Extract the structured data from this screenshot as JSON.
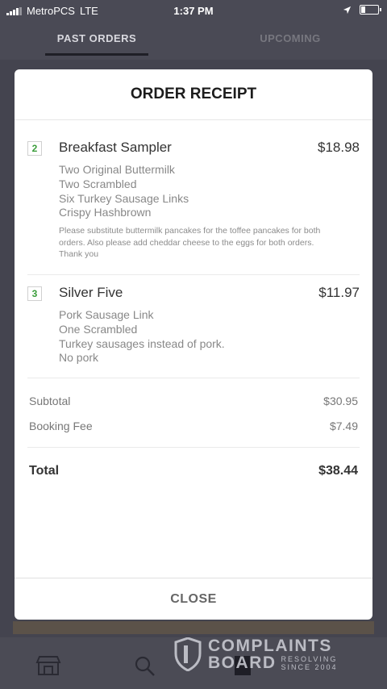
{
  "status_bar": {
    "carrier": "MetroPCS",
    "network": "LTE",
    "time": "1:37 PM"
  },
  "background_tabs": {
    "past": "PAST ORDERS",
    "upcoming": "UPCOMING"
  },
  "modal": {
    "title": "ORDER RECEIPT",
    "items": [
      {
        "quantity": "2",
        "name": "Breakfast Sampler",
        "price": "$18.98",
        "modifiers": [
          "Two Original Buttermilk",
          "Two Scrambled",
          "Six Turkey Sausage Links",
          "Crispy Hashbrown"
        ],
        "note": "Please substitute buttermilk pancakes for the toffee pancakes for both orders. Also please add cheddar cheese to the eggs for both orders. Thank you"
      },
      {
        "quantity": "3",
        "name": "Silver Five",
        "price": "$11.97",
        "modifiers": [
          "Pork Sausage Link",
          "One Scrambled",
          "Turkey sausages instead of pork.",
          "No pork"
        ]
      }
    ],
    "summary": {
      "subtotal_label": "Subtotal",
      "subtotal_value": "$30.95",
      "fee_label": "Booking Fee",
      "fee_value": "$7.49",
      "total_label": "Total",
      "total_value": "$38.44"
    },
    "close_label": "CLOSE"
  },
  "watermark": {
    "line1": "COMPLAINTS",
    "line2": "BOARD",
    "tag_top": "RESOLVING",
    "tag_bottom": "SINCE 2004"
  },
  "icons": {
    "nav": [
      "store-icon",
      "search-icon",
      "orders-icon"
    ]
  },
  "colors": {
    "quantity_green": "#3a9d3a",
    "overlay_background": "#44444f"
  }
}
